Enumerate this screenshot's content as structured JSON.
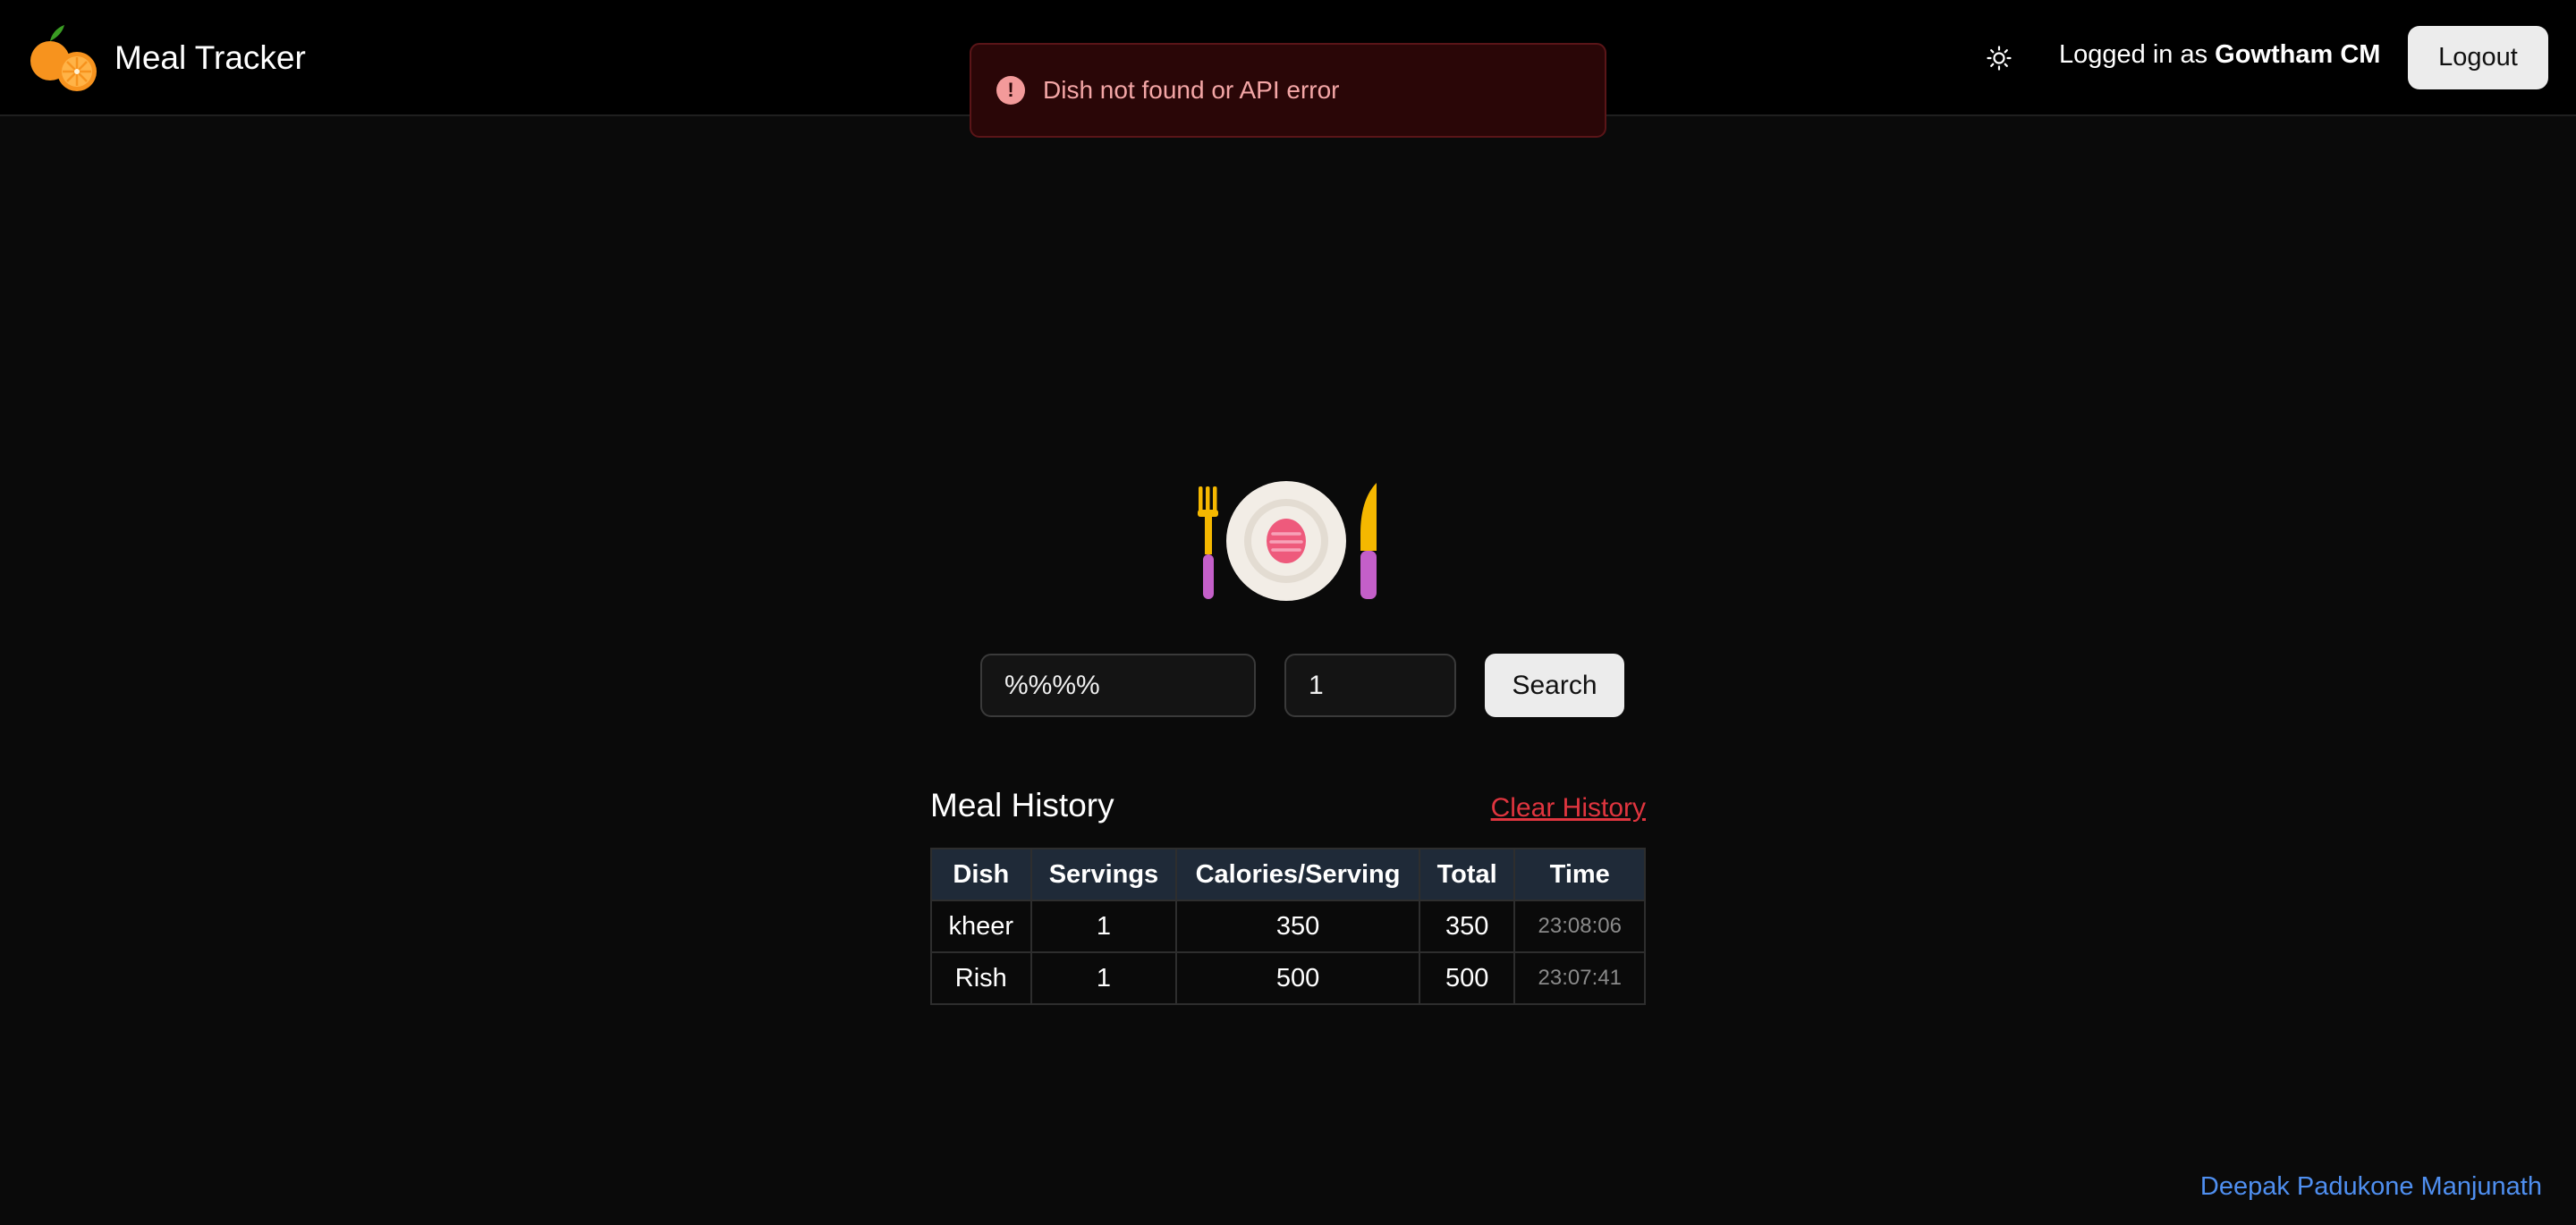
{
  "header": {
    "app_title": "Meal Tracker",
    "logo_icon": "orange-fruit-logo",
    "theme_icon": "sun-icon",
    "logged_in_prefix": "Logged in as ",
    "username": "Gowtham CM",
    "logout_label": "Logout"
  },
  "toast": {
    "icon": "alert-circle-icon",
    "message": "Dish not found or API error",
    "color": "#f4a6a6"
  },
  "hero": {
    "icon": "plate-with-cutlery-icon"
  },
  "search": {
    "dish_value": "%%%%",
    "servings_value": "1",
    "button_label": "Search"
  },
  "history": {
    "title": "Meal History",
    "clear_label": "Clear History",
    "columns": [
      "Dish",
      "Servings",
      "Calories/Serving",
      "Total",
      "Time"
    ],
    "rows": [
      {
        "dish": "kheer",
        "servings": "1",
        "calories": "350",
        "total": "350",
        "time": "23:08:06"
      },
      {
        "dish": "Rish",
        "servings": "1",
        "calories": "500",
        "total": "500",
        "time": "23:07:41"
      }
    ]
  },
  "footer": {
    "author": "Deepak Padukone Manjunath"
  },
  "colors": {
    "background": "#0a0a0a",
    "header_bg": "#000000",
    "accent_red": "#e0353f",
    "link_blue": "#4f8ff0",
    "table_header_bg": "#1f2a38"
  }
}
